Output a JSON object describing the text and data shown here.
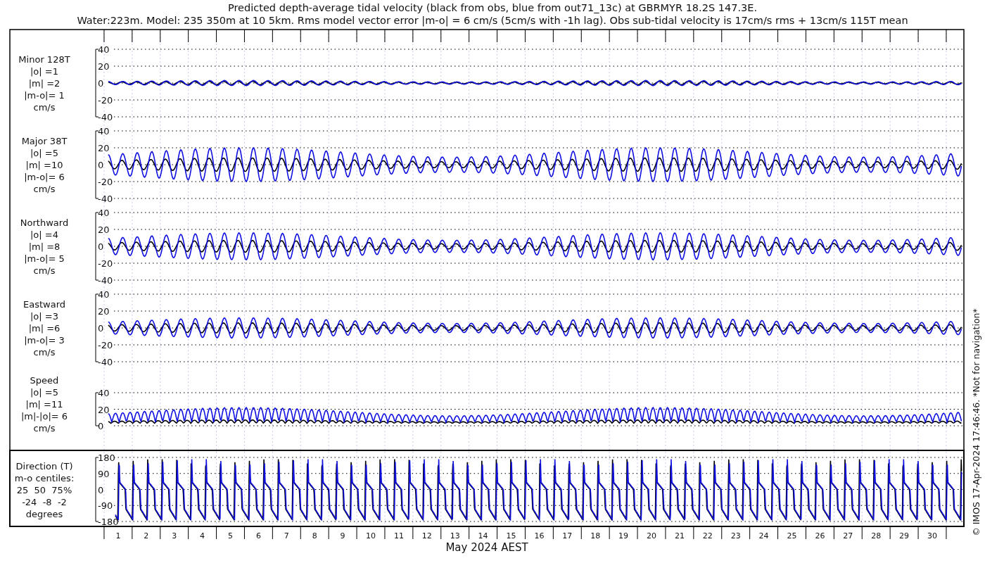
{
  "title": [
    "Predicted depth-average tidal velocity (black from obs, blue from out71_13c) at GBRMYR 18.2S 147.3E.",
    "Water:223m. Model: 235 350m at 10 5km. Rms model vector error |m-o| = 6 cm/s (5cm/s with -1h lag). Obs sub-tidal velocity is 17cm/s rms + 13cm/s 115T mean"
  ],
  "panels": [
    {
      "kind": "signed",
      "label": [
        "Minor 128T",
        "|o| =1",
        "|m| =2",
        "|m-o|= 1",
        "cm/s"
      ],
      "yticks": [
        "40",
        "20",
        "0",
        "-20",
        "-40"
      ]
    },
    {
      "kind": "signed",
      "label": [
        "Major 38T",
        "|o| =5",
        "|m| =10",
        "|m-o|= 6",
        "cm/s"
      ],
      "yticks": [
        "40",
        "20",
        "0",
        "-20",
        "-40"
      ]
    },
    {
      "kind": "signed",
      "label": [
        "Northward",
        "|o| =4",
        "|m| =8",
        "|m-o|= 5",
        "cm/s"
      ],
      "yticks": [
        "40",
        "20",
        "0",
        "-20",
        "-40"
      ]
    },
    {
      "kind": "signed",
      "label": [
        "Eastward",
        "|o| =3",
        "|m| =6",
        "|m-o|= 3",
        "cm/s"
      ],
      "yticks": [
        "40",
        "20",
        "0",
        "-20",
        "-40"
      ]
    },
    {
      "kind": "speed",
      "label": [
        "Speed",
        "|o| =5",
        "|m| =11",
        "|m|-|o|= 6",
        "cm/s"
      ],
      "yticks": [
        "40",
        "20",
        "0"
      ]
    },
    {
      "kind": "direction",
      "label": [
        "Direction (T)",
        "m-o centiles:",
        "25  50  75%",
        "-24  -8  -2",
        "degrees"
      ],
      "yticks": [
        "180",
        "90",
        "0",
        "-90",
        "-180"
      ]
    }
  ],
  "days": [
    "1",
    "2",
    "3",
    "4",
    "5",
    "6",
    "7",
    "8",
    "9",
    "10",
    "11",
    "12",
    "13",
    "14",
    "15",
    "16",
    "17",
    "18",
    "19",
    "20",
    "21",
    "22",
    "23",
    "24",
    "25",
    "26",
    "27",
    "28",
    "29",
    "30"
  ],
  "xlabel": "May 2024 AEST",
  "credit": "© IMOS 17-Apr-2024 17:46:46. *Not for navigation*"
}
